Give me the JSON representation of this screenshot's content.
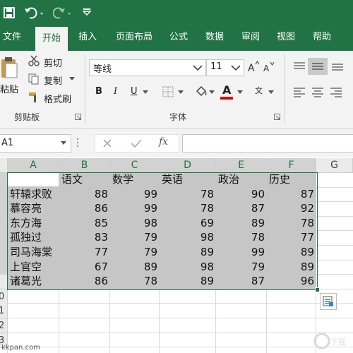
{
  "qat": {
    "save_icon": "save-icon",
    "undo_icon": "undo-icon",
    "redo_icon": "redo-icon",
    "customize_icon": "customize-icon"
  },
  "tabs": [
    {
      "label": "文件"
    },
    {
      "label": "开始"
    },
    {
      "label": "插入"
    },
    {
      "label": "页面布局"
    },
    {
      "label": "公式"
    },
    {
      "label": "数据"
    },
    {
      "label": "审阅"
    },
    {
      "label": "视图"
    },
    {
      "label": "帮助"
    }
  ],
  "clipboard": {
    "paste": "粘贴",
    "cut": "剪切",
    "copy": "复制",
    "format_painter": "格式刷",
    "group": "剪贴板"
  },
  "font": {
    "name": "等线",
    "size": "11",
    "group": "字体",
    "bold": "B",
    "italic": "I",
    "underline": "U",
    "font_color_glyph": "A",
    "wen_glyph": "文"
  },
  "namebox": "A1",
  "formula": {
    "fx": "fx",
    "value": ""
  },
  "columns": [
    "A",
    "B",
    "C",
    "D",
    "E",
    "F",
    "G"
  ],
  "rows": [
    "",
    "",
    "",
    "",
    "",
    "",
    "",
    "",
    "0",
    "1",
    "2",
    "3"
  ],
  "table": {
    "headers": [
      "",
      "语文",
      "数学",
      "英语",
      "政治",
      "历史"
    ],
    "rows": [
      [
        "轩辕求败",
        "88",
        "99",
        "78",
        "90",
        "87"
      ],
      [
        "慕容亮",
        "86",
        "99",
        "78",
        "87",
        "92"
      ],
      [
        "东方海",
        "85",
        "98",
        "69",
        "89",
        "78"
      ],
      [
        "孤独过",
        "83",
        "79",
        "98",
        "78",
        "77"
      ],
      [
        "司马海棠",
        "77",
        "79",
        "89",
        "99",
        "89"
      ],
      [
        "上官空",
        "67",
        "89",
        "98",
        "79",
        "89"
      ],
      [
        "诸葛光",
        "86",
        "78",
        "89",
        "87",
        "96"
      ]
    ]
  },
  "watermark": "kkpan.com",
  "colors": {
    "accent": "#217346",
    "selection": "#c6c6c6"
  }
}
